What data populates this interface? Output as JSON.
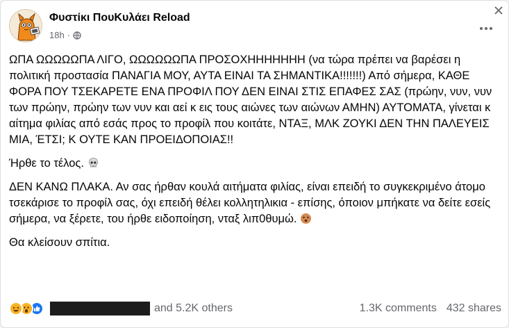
{
  "post": {
    "page_name": "Φυστίκι ΠουΚυλάει Reload",
    "time": "18h",
    "separator": "·",
    "paragraphs": [
      "ΩΠΑ ΩΩΩΩΩΠΑ ΛΙΓΟ, ΩΩΩΩΩΩΠΑ ΠΡΟΣΟΧΗΗΗΗΗΗΗ (να τώρα πρέπει να βαρέσει η πολιτική προστασία ΠΑΝΑΓΙΑ ΜΟΥ, ΑΥΤΑ ΕΙΝΑΙ ΤΑ ΣΗΜΑΝΤΙΚΑ!!!!!!!) Από σήμερα, ΚΑΘΕ ΦΟΡΑ ΠΟΥ ΤΣΕΚΑΡΕΤΕ ΕΝΑ ΠΡΟΦΙΛ ΠΟΥ ΔΕΝ ΕΙΝΑΙ ΣΤΙΣ ΕΠΑΦΕΣ ΣΑΣ (πρώην, νυν, νυν των πρώην, πρώην των νυν και αεί κ εις τους αιώνες των αιώνων ΑΜΗΝ) ΑΥΤΟΜΑΤΑ, γίνεται κ αίτημα φιλίας από εσάς προς το προφίλ που κοιτάτε, ΝΤΑΞ, ΜΛΚ ΖΟΥΚΙ ΔΕΝ ΤΗΝ ΠΑΛΕΥΕΙΣ ΜΙΑ, ΈΤΣΙ; Κ ΟΥΤΕ ΚΑΝ ΠΡΟΕΙΔΟΠΟΙΑΣ!!",
      "Ήρθε το τέλος.",
      "ΔΕΝ ΚΑΝΩ ΠΛΑΚΑ. Αν σας ήρθαν κουλά αιτήματα φιλίας, είναι επειδή το συγκεκριμένο άτομο τσεκάρισε το προφίλ σας, όχι επειδή θέλει κολλητηλικια - επίσης, όποιον μπήκατε να δείτε εσείς σήμερα, να ξέρετε, του ήρθε ειδοποίηση, νταξ λιπ0θυμώ.",
      "Θα κλείσουν σπίτια."
    ]
  },
  "stats": {
    "others": "and 5.2K others",
    "comments": "1.3K comments",
    "shares": "432 shares"
  },
  "icons": {
    "more": "more-horizontal-icon",
    "close": "close-icon",
    "privacy": "globe-icon",
    "skull": "skull-emoji",
    "dizzy": "dizzy-face-emoji",
    "reactions": [
      "haha-reaction",
      "wow-reaction",
      "like-reaction"
    ]
  },
  "colors": {
    "like_blue": "#1877f2",
    "reaction_yellow": "#f7b125",
    "secondary_text": "#65676b"
  }
}
